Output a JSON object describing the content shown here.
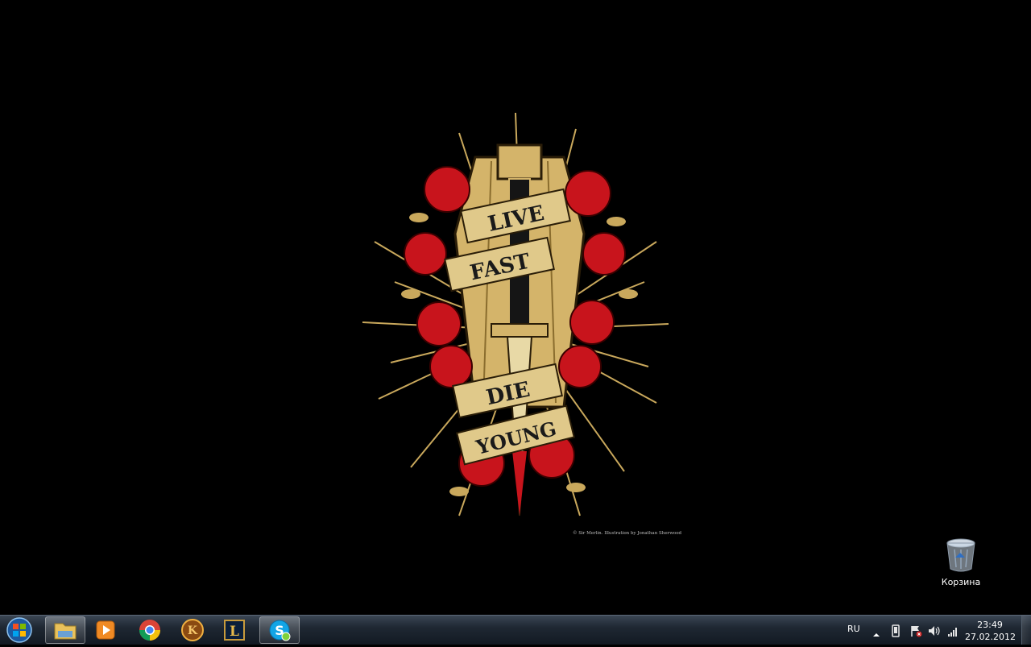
{
  "wallpaper": {
    "banner_words": [
      "LIVE",
      "FAST",
      "DIE",
      "YOUNG"
    ],
    "credit": "© Sir Merlin. Illustration by Jonathan Sherwood"
  },
  "desktop_icons": [
    {
      "name": "recycle-bin",
      "label": "Корзина"
    }
  ],
  "taskbar": {
    "start_icon": "windows-orb-icon",
    "pinned": [
      {
        "name": "explorer",
        "icon": "folder-icon",
        "active": true
      },
      {
        "name": "media-player",
        "icon": "media-player-icon",
        "active": false
      },
      {
        "name": "chrome",
        "icon": "chrome-icon",
        "active": false
      },
      {
        "name": "game-launcher",
        "icon": "launcher-icon",
        "active": false
      },
      {
        "name": "league-of-legends",
        "icon": "league-icon",
        "active": false
      },
      {
        "name": "skype",
        "icon": "skype-icon",
        "active": true
      }
    ],
    "tray": {
      "language": "RU",
      "icons": [
        "show-hidden-icons-arrow",
        "device-icon",
        "action-center-flag-icon",
        "volume-icon",
        "network-signal-icon"
      ],
      "time": "23:49",
      "date": "27.02.2012"
    }
  },
  "colors": {
    "gold": "#d4b46a",
    "rose_red": "#c8141c",
    "taskbar_top": "#3b4654",
    "taskbar_bottom": "#121922"
  }
}
